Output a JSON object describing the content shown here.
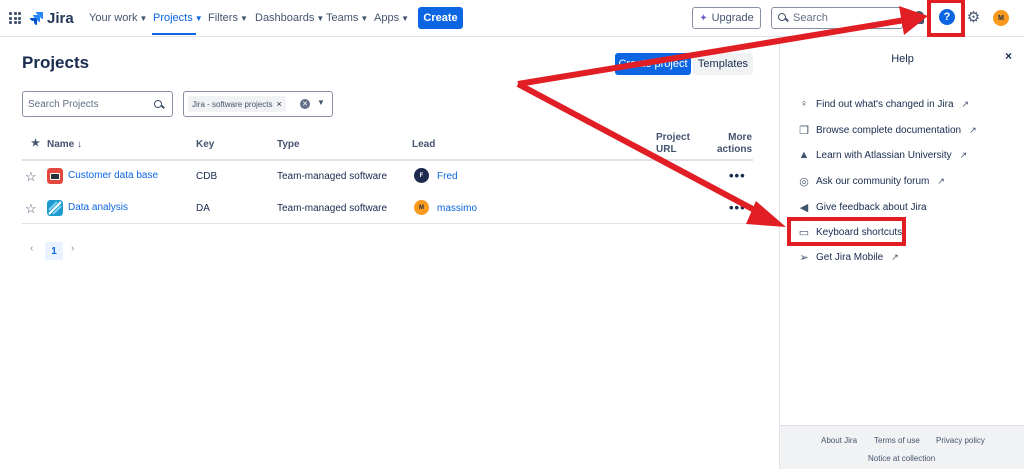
{
  "topnav": {
    "logo_text": "Jira",
    "items": [
      {
        "label": "Your work"
      },
      {
        "label": "Projects"
      },
      {
        "label": "Filters"
      },
      {
        "label": "Dashboards"
      },
      {
        "label": "Teams"
      },
      {
        "label": "Apps"
      }
    ],
    "create_label": "Create",
    "upgrade_label": "Upgrade",
    "search_placeholder": "Search",
    "help_icon_glyph": "?",
    "avatar_initial": "M"
  },
  "main": {
    "title": "Projects",
    "create_project_label": "Create project",
    "templates_label": "Templates",
    "search_placeholder": "Search Projects",
    "filter_tag": "Jira - software projects",
    "columns": {
      "name": "Name",
      "key": "Key",
      "type": "Type",
      "lead": "Lead",
      "project_url_line1": "Project",
      "project_url_line2": "URL",
      "more_actions_line1": "More",
      "more_actions_line2": "actions"
    },
    "rows": [
      {
        "name": "Customer data base",
        "key": "CDB",
        "type": "Team-managed software",
        "lead": "Fred",
        "lead_initial": "F",
        "icon_color": "#e2483d",
        "lead_color": "#1d2b4f"
      },
      {
        "name": "Data analysis",
        "key": "DA",
        "type": "Team-managed software",
        "lead": "massimo",
        "lead_initial": "M",
        "icon_color": "#1d9bd1",
        "lead_color": "#f79a1e"
      }
    ],
    "more_glyph": "•••",
    "pagination": {
      "prev": "‹",
      "current": "1",
      "next": "›"
    }
  },
  "help": {
    "title": "Help",
    "close_glyph": "×",
    "items": [
      {
        "label": "Find out what's changed in Jira",
        "icon": "lightbulb-icon",
        "glyph": "💡",
        "external": true
      },
      {
        "label": "Browse complete documentation",
        "icon": "document-icon",
        "glyph": "❐",
        "external": true
      },
      {
        "label": "Learn with Atlassian University",
        "icon": "atlassian-icon",
        "glyph": "▲",
        "external": true
      },
      {
        "label": "Ask our community forum",
        "icon": "comment-icon",
        "glyph": "◎",
        "external": true
      },
      {
        "label": "Give feedback about Jira",
        "icon": "megaphone-icon",
        "glyph": "📢",
        "external": false
      },
      {
        "label": "Keyboard shortcuts",
        "icon": "keyboard-icon",
        "glyph": "▭",
        "external": false
      },
      {
        "label": "Get Jira Mobile",
        "icon": "send-icon",
        "glyph": "➢",
        "external": true
      }
    ],
    "external_glyph": "↗",
    "footer": {
      "about": "About Jira",
      "terms": "Terms of use",
      "privacy": "Privacy policy",
      "notice": "Notice at collection"
    }
  },
  "colors": {
    "brand_blue": "#0c66e4",
    "annotation_red": "#e01e24"
  }
}
